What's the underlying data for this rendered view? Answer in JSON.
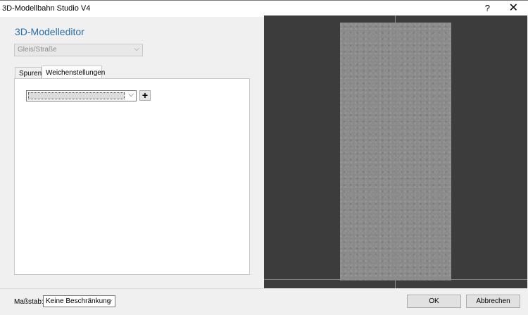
{
  "window": {
    "title": "3D-Modellbahn Studio V4",
    "help": "?",
    "close": "✕"
  },
  "editor": {
    "heading": "3D-Modelleditor"
  },
  "category": {
    "value": "Gleis/Straße"
  },
  "tabs": [
    {
      "label": "Spuren"
    },
    {
      "label": "Weichenstellungen"
    }
  ],
  "switch_settings": {
    "selected": "",
    "add_label": "+"
  },
  "footer": {
    "scale_label": "Maßstab:",
    "scale_value": "Keine Beschränkung",
    "ok_label": "OK",
    "cancel_label": "Abbrechen"
  },
  "icons": {
    "dropdown": "chevron-down-icon",
    "close": "close-icon",
    "help": "help-icon",
    "add": "plus-icon"
  }
}
